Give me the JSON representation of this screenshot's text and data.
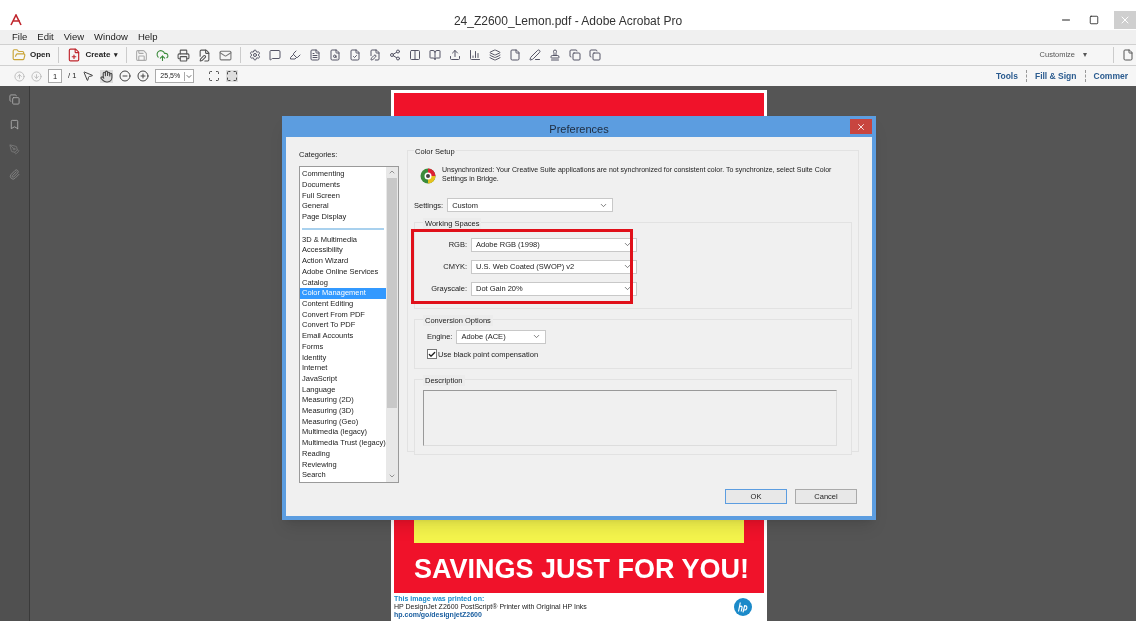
{
  "window": {
    "title": "24_Z2600_Lemon.pdf - Adobe Acrobat Pro"
  },
  "menu": [
    "File",
    "Edit",
    "View",
    "Window",
    "Help"
  ],
  "toolbar": {
    "open": "Open",
    "create": "Create",
    "create_caret": "▾",
    "customize": "Customize",
    "customize_caret": "▾"
  },
  "nav_toolbar": {
    "page": "1",
    "page_total": "/ 1",
    "zoom": "25,5%",
    "tabs": [
      {
        "label": "Tools",
        "selected": false
      },
      {
        "label": "Fill & Sign",
        "selected": false
      },
      {
        "label": "Commer",
        "selected": false
      }
    ]
  },
  "document": {
    "headline": "SAVINGS JUST FOR YOU!",
    "footer_title": "This image was printed on:",
    "footer_text": "HP DesignJet Z2600 PostScript® Printer with Original HP Inks",
    "footer_link": "hp.com/go/designjetZ2600"
  },
  "dialog": {
    "title": "Preferences",
    "categories_label": "Categories:",
    "categories": [
      {
        "label": "Commenting",
        "selected": false,
        "divider_after": false
      },
      {
        "label": "Documents",
        "selected": false,
        "divider_after": false
      },
      {
        "label": "Full Screen",
        "selected": false,
        "divider_after": false
      },
      {
        "label": "General",
        "selected": false,
        "divider_after": false
      },
      {
        "label": "Page Display",
        "selected": false,
        "divider_after": true
      },
      {
        "label": "3D & Multimedia",
        "selected": false,
        "divider_after": false
      },
      {
        "label": "Accessibility",
        "selected": false,
        "divider_after": false
      },
      {
        "label": "Action Wizard",
        "selected": false,
        "divider_after": false
      },
      {
        "label": "Adobe Online Services",
        "selected": false,
        "divider_after": false
      },
      {
        "label": "Catalog",
        "selected": false,
        "divider_after": false
      },
      {
        "label": "Color Management",
        "selected": true,
        "divider_after": false
      },
      {
        "label": "Content Editing",
        "selected": false,
        "divider_after": false
      },
      {
        "label": "Convert From PDF",
        "selected": false,
        "divider_after": false
      },
      {
        "label": "Convert To PDF",
        "selected": false,
        "divider_after": false
      },
      {
        "label": "Email Accounts",
        "selected": false,
        "divider_after": false
      },
      {
        "label": "Forms",
        "selected": false,
        "divider_after": false
      },
      {
        "label": "Identity",
        "selected": false,
        "divider_after": false
      },
      {
        "label": "Internet",
        "selected": false,
        "divider_after": false
      },
      {
        "label": "JavaScript",
        "selected": false,
        "divider_after": false
      },
      {
        "label": "Language",
        "selected": false,
        "divider_after": false
      },
      {
        "label": "Measuring (2D)",
        "selected": false,
        "divider_after": false
      },
      {
        "label": "Measuring (3D)",
        "selected": false,
        "divider_after": false
      },
      {
        "label": "Measuring (Geo)",
        "selected": false,
        "divider_after": false
      },
      {
        "label": "Multimedia (legacy)",
        "selected": false,
        "divider_after": false
      },
      {
        "label": "Multimedia Trust (legacy)",
        "selected": false,
        "divider_after": false
      },
      {
        "label": "Reading",
        "selected": false,
        "divider_after": false
      },
      {
        "label": "Reviewing",
        "selected": false,
        "divider_after": false
      },
      {
        "label": "Search",
        "selected": false,
        "divider_after": false
      }
    ],
    "color_setup": {
      "title": "Color Setup",
      "message": "Unsynchronized: Your Creative Suite applications are not synchronized for consistent color. To synchronize, select Suite Color Settings in Bridge.",
      "settings_label": "Settings:",
      "settings_value": "Custom"
    },
    "working_spaces": {
      "title": "Working Spaces",
      "highlighted": true,
      "fields": [
        {
          "label": "RGB:",
          "value": "Adobe RGB (1998)"
        },
        {
          "label": "CMYK:",
          "value": "U.S. Web Coated (SWOP) v2"
        },
        {
          "label": "Grayscale:",
          "value": "Dot Gain 20%"
        }
      ]
    },
    "conversion": {
      "title": "Conversion Options",
      "engine_label": "Engine:",
      "engine_value": "Adobe (ACE)",
      "black_point_label": "Use black point compensation",
      "black_point_checked": true
    },
    "description": {
      "title": "Description"
    },
    "buttons": [
      "OK",
      "Cancel"
    ]
  }
}
